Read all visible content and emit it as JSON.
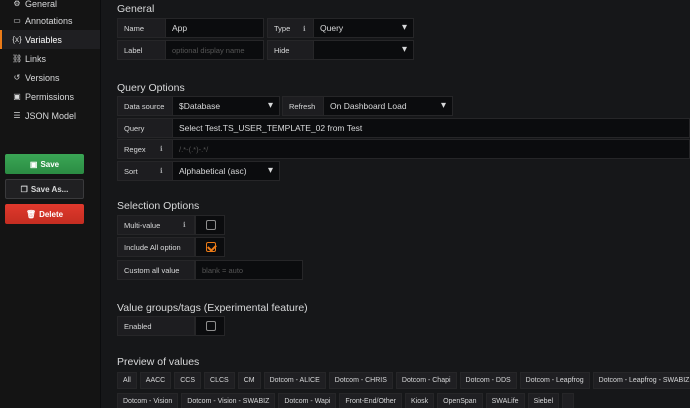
{
  "sidebar": {
    "items": [
      {
        "label": "General",
        "icon": "gear-icon",
        "glyph": "⚙"
      },
      {
        "label": "Annotations",
        "icon": "comment-icon",
        "glyph": "▭"
      },
      {
        "label": "Variables",
        "icon": "variable-icon",
        "glyph": "{x}"
      },
      {
        "label": "Links",
        "icon": "link-icon",
        "glyph": "⛓"
      },
      {
        "label": "Versions",
        "icon": "history-icon",
        "glyph": "↺"
      },
      {
        "label": "Permissions",
        "icon": "lock-icon",
        "glyph": "🔒"
      },
      {
        "label": "JSON Model",
        "icon": "code-icon",
        "glyph": "☰"
      }
    ],
    "save_label": "Save",
    "save_as_label": "Save As...",
    "delete_label": "Delete"
  },
  "general": {
    "title": "General",
    "name_label": "Name",
    "name_value": "App",
    "type_label": "Type",
    "type_value": "Query",
    "label_label": "Label",
    "label_placeholder": "optional display name",
    "hide_label": "Hide",
    "hide_value": ""
  },
  "query_options": {
    "title": "Query Options",
    "datasource_label": "Data source",
    "datasource_value": "$Database",
    "refresh_label": "Refresh",
    "refresh_value": "On Dashboard Load",
    "query_label": "Query",
    "query_value": "Select Test.TS_USER_TEMPLATE_02 from Test",
    "regex_label": "Regex",
    "regex_placeholder": "/.*-(.*)-.*/",
    "sort_label": "Sort",
    "sort_value": "Alphabetical (asc)"
  },
  "selection_options": {
    "title": "Selection Options",
    "multi_label": "Multi-value",
    "multi_checked": false,
    "include_all_label": "Include All option",
    "include_all_checked": true,
    "custom_all_label": "Custom all value",
    "custom_all_placeholder": "blank = auto"
  },
  "value_groups": {
    "title": "Value groups/tags (Experimental feature)",
    "enabled_label": "Enabled",
    "enabled_checked": false
  },
  "preview": {
    "title": "Preview of values",
    "row1": [
      "All",
      "AACC",
      "CCS",
      "CLCS",
      "CM",
      "Dotcom - ALICE",
      "Dotcom - CHRIS",
      "Dotcom - Chapi",
      "Dotcom - DDS",
      "Dotcom - Leapfrog",
      "Dotcom - Leapfrog - SWABIZ"
    ],
    "row2": [
      "Dotcom - Vision",
      "Dotcom - Vision - SWABIZ",
      "Dotcom - Wapi",
      "Front-End/Other",
      "Kiosk",
      "OpenSpan",
      "SWALife",
      "Siebel",
      ""
    ]
  },
  "colors": {
    "accent": "#eb7b18",
    "save": "#2b8c43",
    "delete": "#c42d21"
  }
}
